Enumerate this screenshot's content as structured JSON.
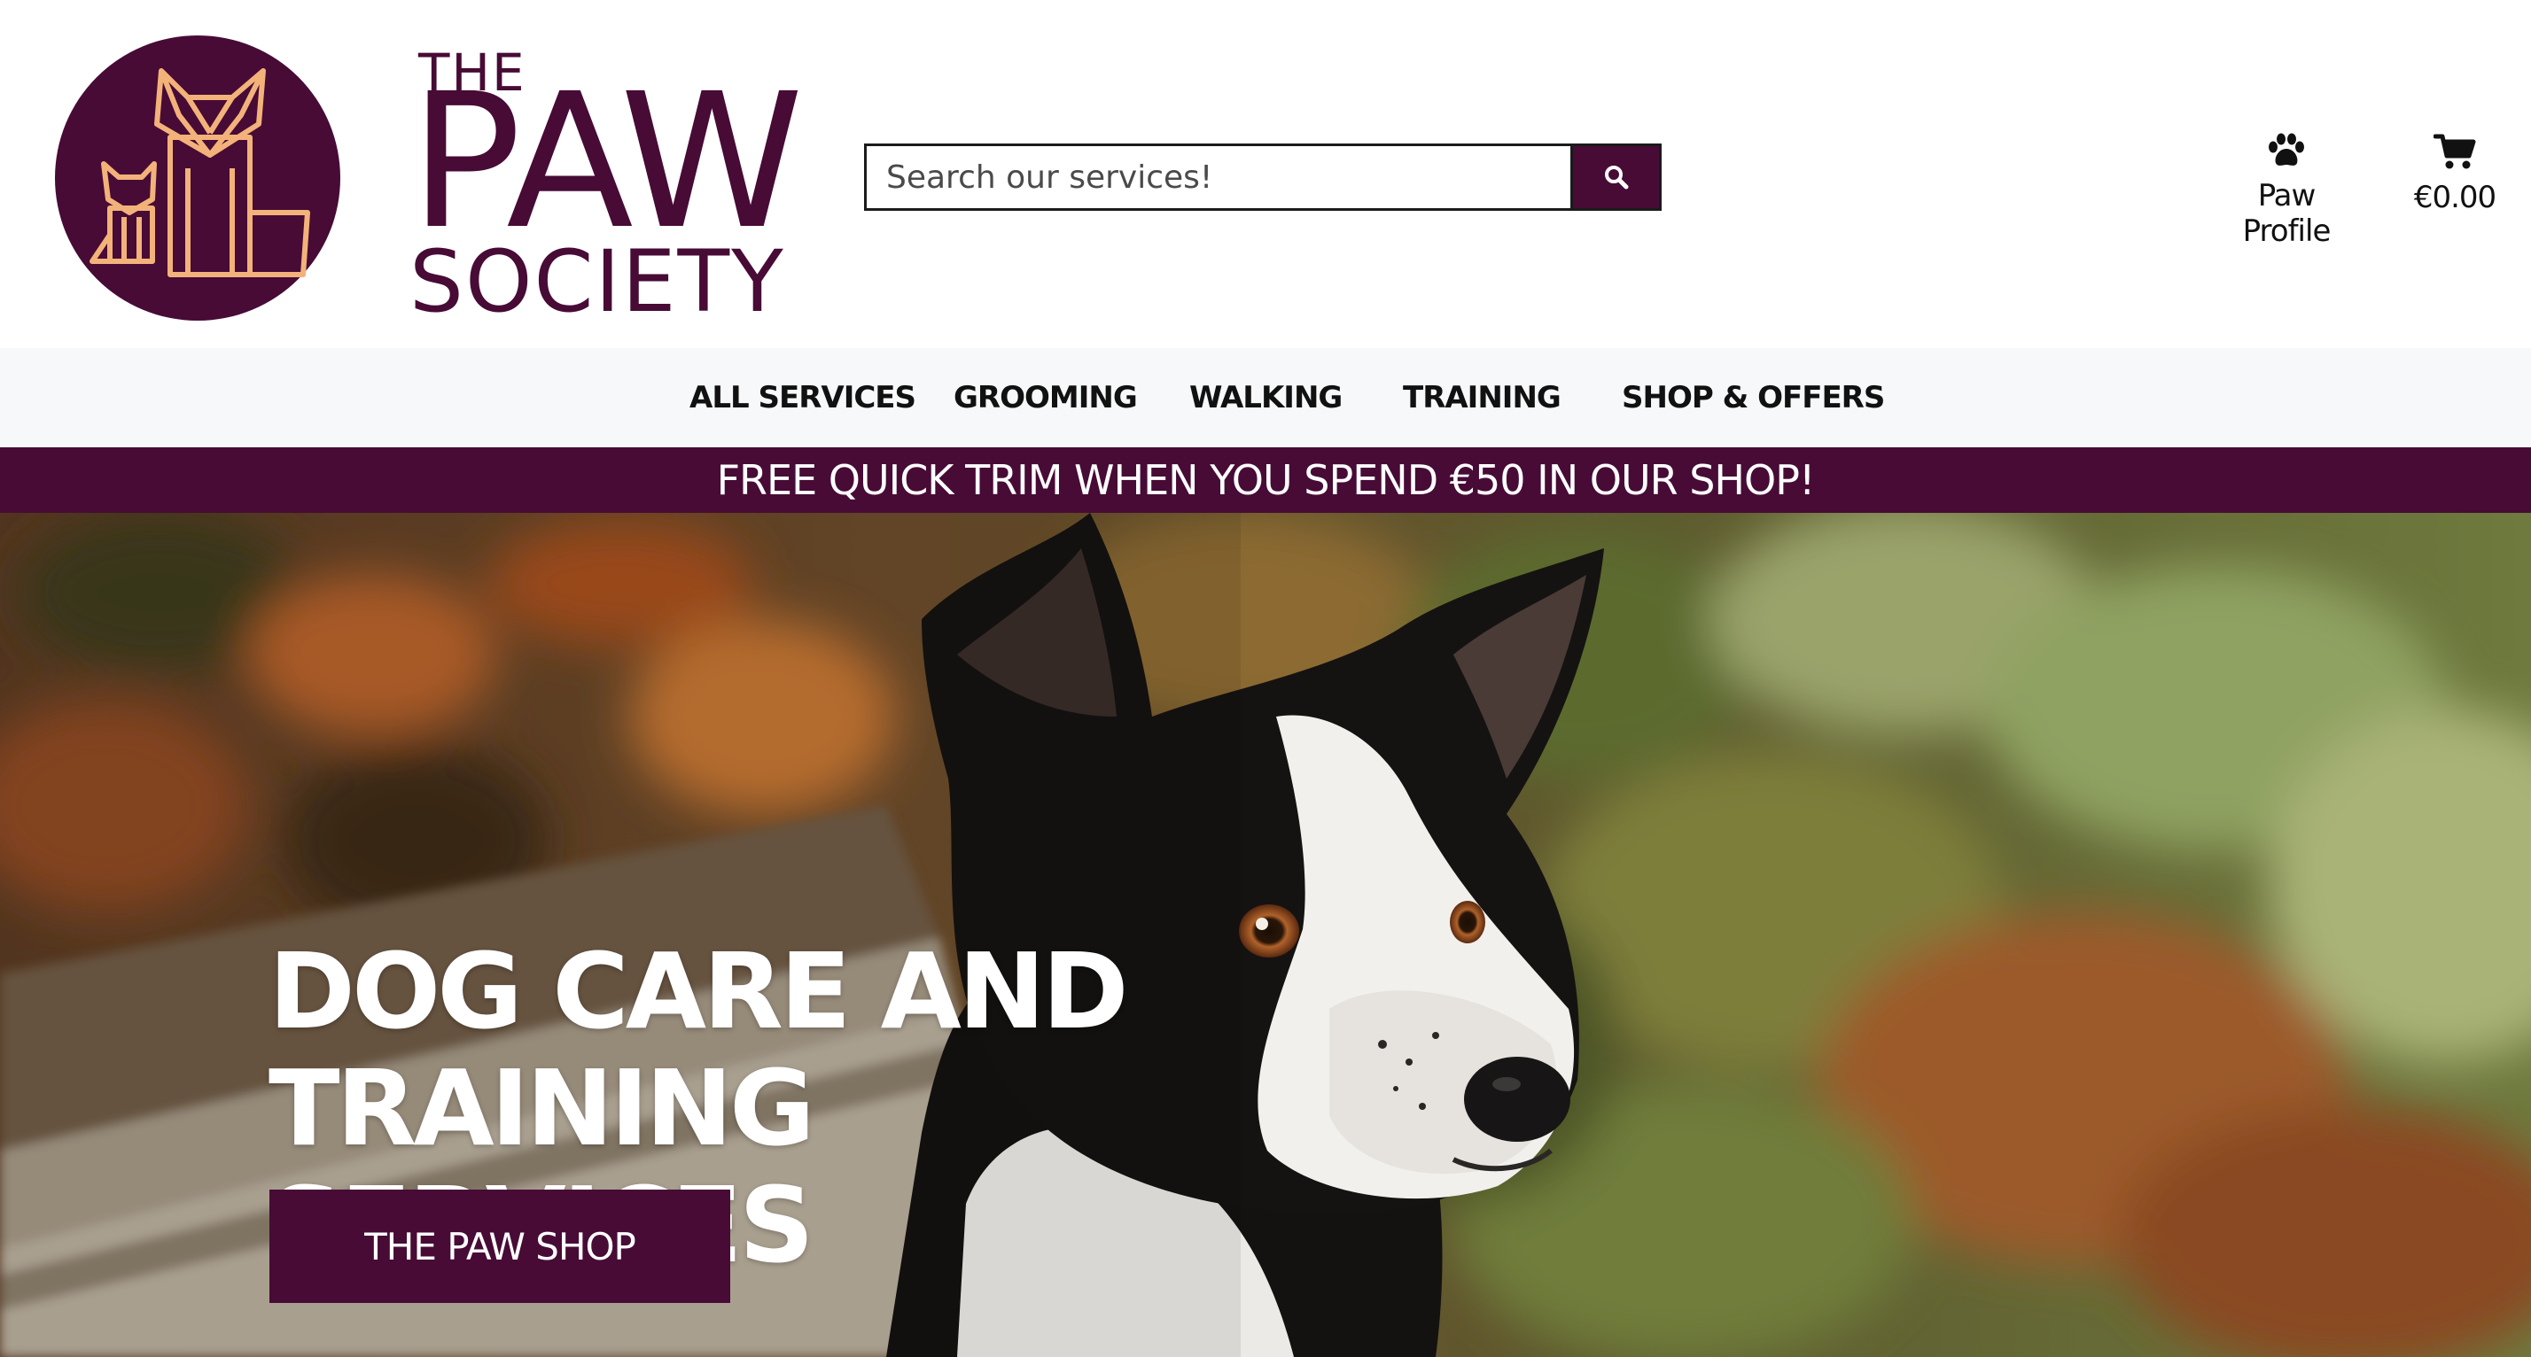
{
  "brand": {
    "line1": "THE",
    "line2": "PAW",
    "line3": "SOCIETY",
    "primary_color": "#470b36",
    "accent_color": "#f3b27a"
  },
  "search": {
    "placeholder": "Search our services!",
    "value": "",
    "icon": "search-icon"
  },
  "account": {
    "profile_label": "Paw Profile",
    "profile_icon": "paw-icon",
    "cart_total": "€0.00",
    "cart_icon": "shopping-cart-icon"
  },
  "nav": {
    "items": [
      {
        "label": "ALL SERVICES"
      },
      {
        "label": "GROOMING"
      },
      {
        "label": "WALKING"
      },
      {
        "label": "TRAINING"
      },
      {
        "label": "SHOP & OFFERS"
      }
    ]
  },
  "banner": {
    "text": "FREE QUICK TRIM WHEN YOU SPEND €50 IN OUR SHOP!"
  },
  "hero": {
    "title": "DOG CARE AND TRAINING SERVICES",
    "button_label": "THE PAW SHOP",
    "image": "black-and-white-border-collie-photo"
  }
}
